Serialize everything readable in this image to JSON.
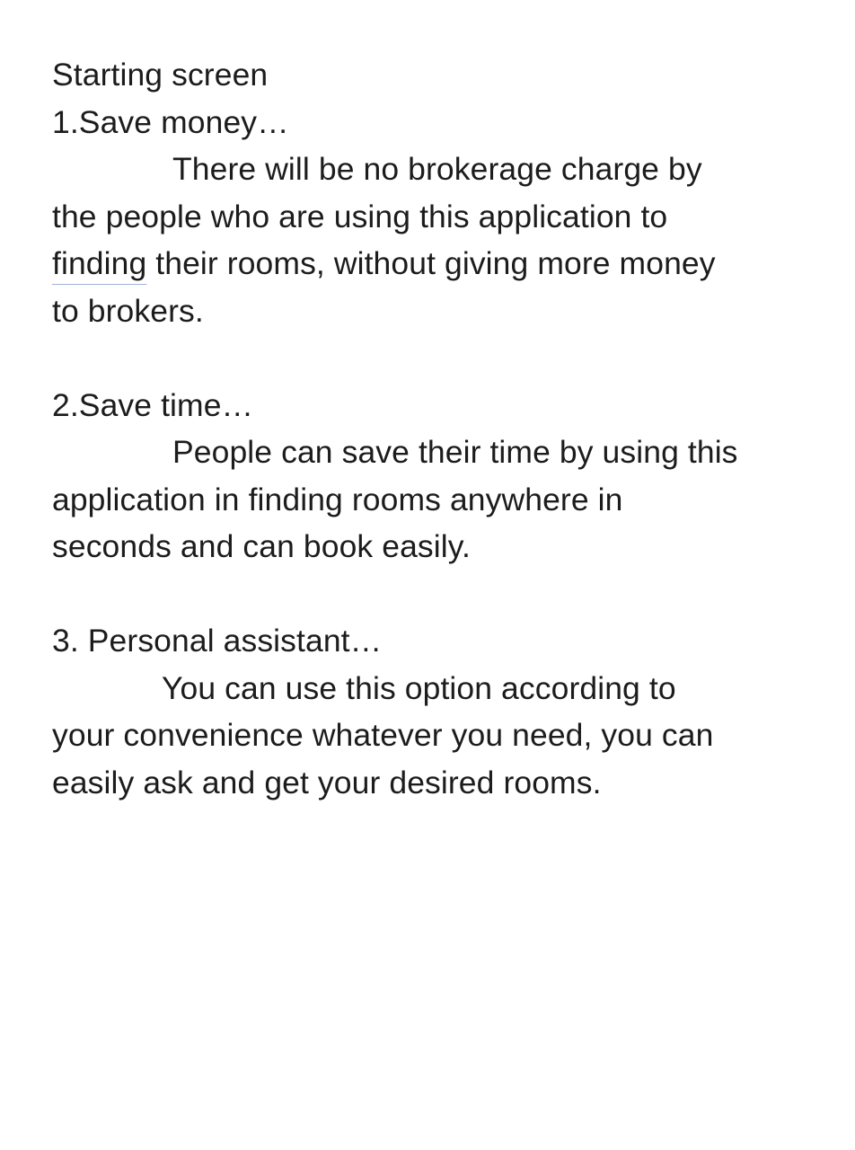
{
  "document": {
    "title": "Starting screen",
    "sections": [
      {
        "heading": "1.Save money…",
        "lines": [
          "There will be no brokerage charge by",
          "the people who are using this application to",
          "finding",
          " their rooms, without giving more money",
          "to brokers."
        ]
      },
      {
        "heading": "2.Save time…",
        "lines": [
          "People can save their time by using this",
          "application in finding rooms anywhere in",
          "seconds and can book easily."
        ]
      },
      {
        "heading": "3. Personal assistant…",
        "lines": [
          "You can use this option according to",
          "your convenience whatever you need, you can",
          "easily ask and get your desired rooms."
        ]
      }
    ]
  }
}
